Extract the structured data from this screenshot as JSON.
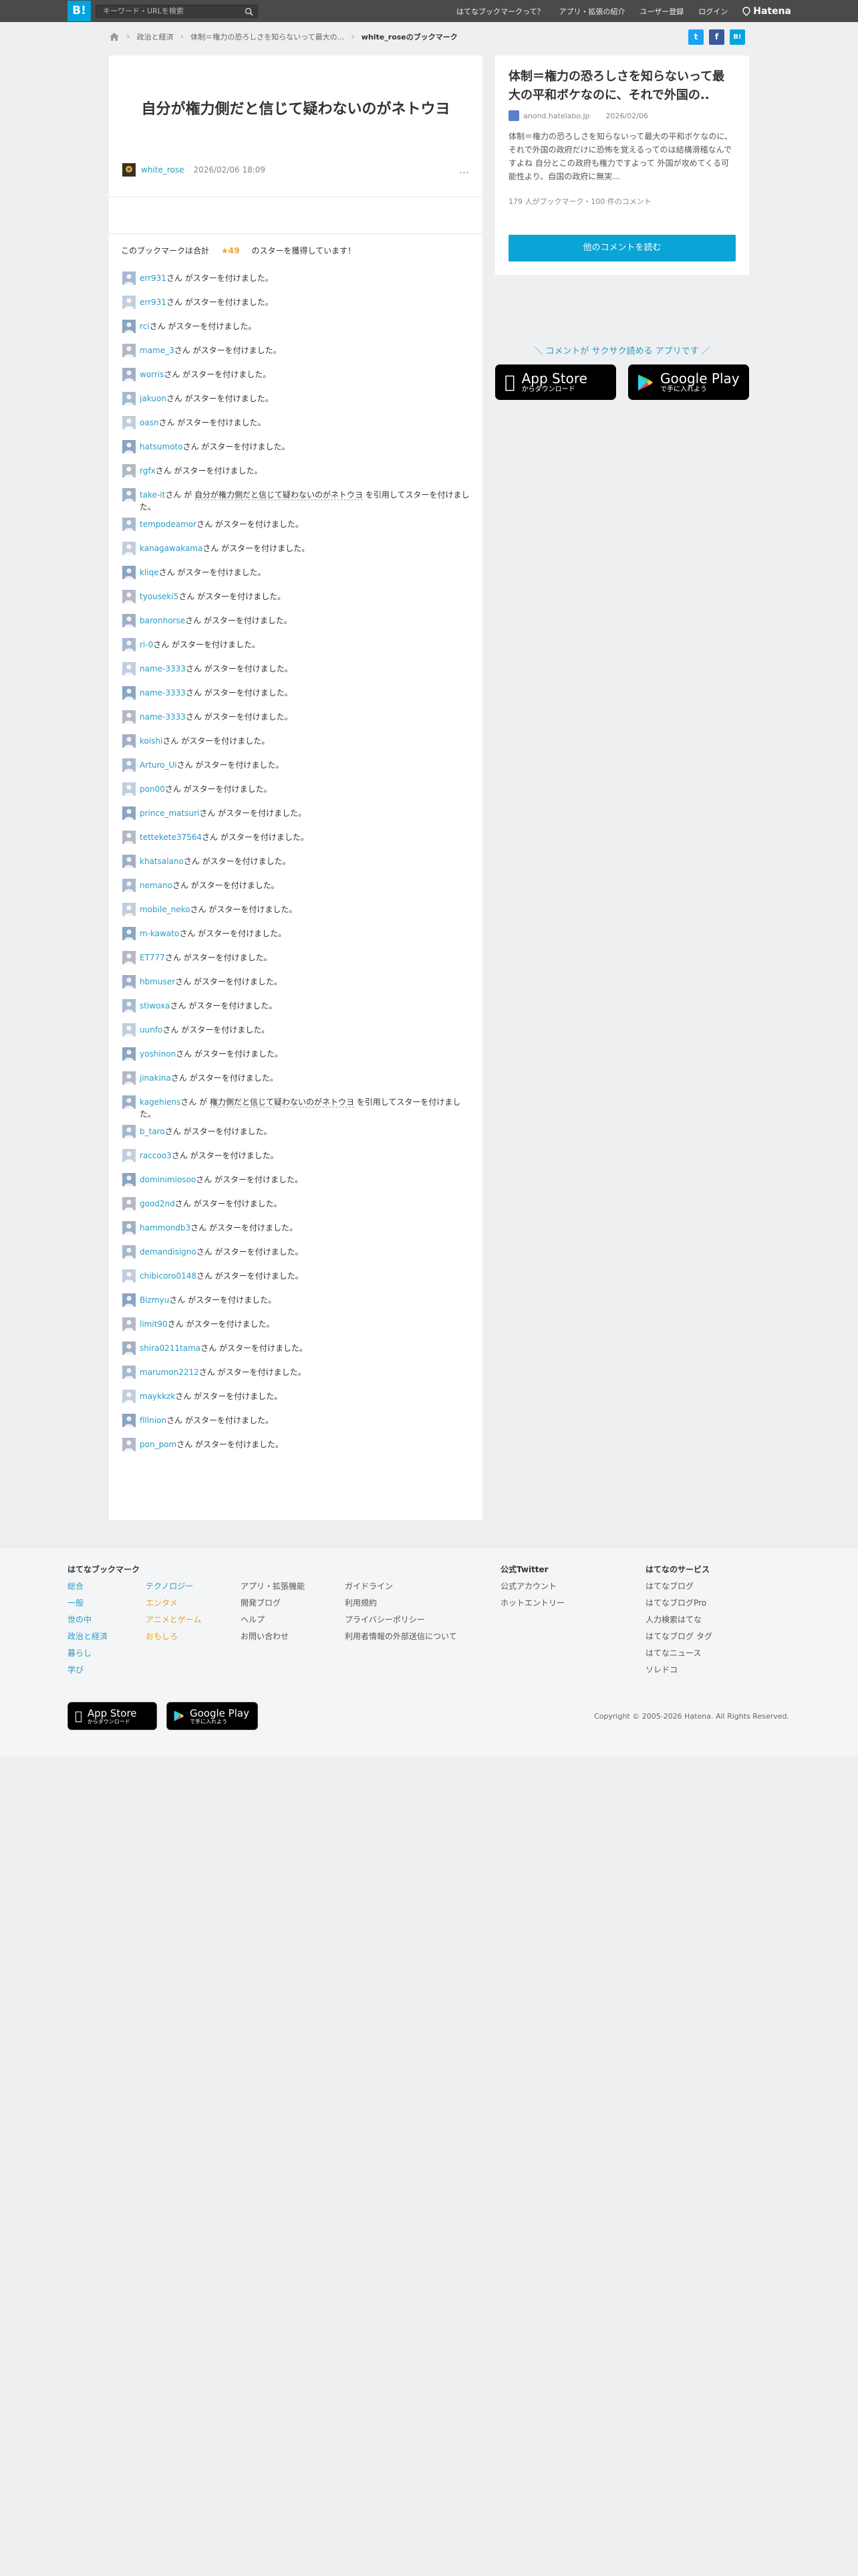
{
  "header": {
    "logo": "B!",
    "search_placeholder": "キーワード・URLを検索",
    "nav": [
      "はてなブックマークって？",
      "アプリ・拡張の紹介",
      "ユーザー登録",
      "ログイン"
    ],
    "brand": "Hatena"
  },
  "breadcrumb": {
    "items": [
      "政治と経済",
      "体制＝権力の恐ろしさを知らないって最大の..."
    ],
    "current": "white_roseのブックマーク"
  },
  "share": {
    "twitter": "t",
    "facebook": "f",
    "hatena": "B!"
  },
  "bookmark": {
    "title": "自分が権力側だと信じて疑わないのがネトウヨ",
    "user": "white_rose",
    "date": "2026/02/06 18:09",
    "more": "…",
    "summary_pre": "このブックマークは合計",
    "summary_star": "★49",
    "summary_post": "のスターを獲得しています！"
  },
  "stars": [
    {
      "user": "err931",
      "text": "さん がスターを付けました。"
    },
    {
      "user": "err931",
      "text": "さん がスターを付けました。"
    },
    {
      "user": "rci",
      "text": "さん がスターを付けました。"
    },
    {
      "user": "mame_3",
      "text": "さん がスターを付けました。"
    },
    {
      "user": "worris",
      "text": "さん がスターを付けました。"
    },
    {
      "user": "jakuon",
      "text": "さん がスターを付けました。"
    },
    {
      "user": "oasn",
      "text": "さん がスターを付けました。"
    },
    {
      "user": "hatsumoto",
      "text": "さん がスターを付けました。"
    },
    {
      "user": "rgfx",
      "text": "さん がスターを付けました。"
    },
    {
      "user": "take-it",
      "text": "さん が",
      "quote": "自分が権力側だと信じて疑わないのがネトウヨ",
      "text2": "を引用してスターを付けました。"
    },
    {
      "user": "tempodeamor",
      "text": "さん がスターを付けました。"
    },
    {
      "user": "kanagawakama",
      "text": "さん がスターを付けました。"
    },
    {
      "user": "kliqe",
      "text": "さん がスターを付けました。"
    },
    {
      "user": "tyouseki5",
      "text": "さん がスターを付けました。"
    },
    {
      "user": "baronhorse",
      "text": "さん がスターを付けました。"
    },
    {
      "user": "ri-0",
      "text": "さん がスターを付けました。"
    },
    {
      "user": "name-3333",
      "text": "さん がスターを付けました。"
    },
    {
      "user": "name-3333",
      "text": "さん がスターを付けました。"
    },
    {
      "user": "name-3333",
      "text": "さん がスターを付けました。"
    },
    {
      "user": "koishi",
      "text": "さん がスターを付けました。"
    },
    {
      "user": "Arturo_Ui",
      "text": "さん がスターを付けました。"
    },
    {
      "user": "pon00",
      "text": "さん がスターを付けました。"
    },
    {
      "user": "prince_matsuri",
      "text": "さん がスターを付けました。"
    },
    {
      "user": "tettekete37564",
      "text": "さん がスターを付けました。"
    },
    {
      "user": "khatsalano",
      "text": "さん がスターを付けました。"
    },
    {
      "user": "nemano",
      "text": "さん がスターを付けました。"
    },
    {
      "user": "mobile_neko",
      "text": "さん がスターを付けました。"
    },
    {
      "user": "m-kawato",
      "text": "さん がスターを付けました。"
    },
    {
      "user": "ET777",
      "text": "さん がスターを付けました。"
    },
    {
      "user": "hbmuser",
      "text": "さん がスターを付けました。"
    },
    {
      "user": "stiwoxa",
      "text": "さん がスターを付けました。"
    },
    {
      "user": "uunfo",
      "text": "さん がスターを付けました。"
    },
    {
      "user": "yoshinon",
      "text": "さん がスターを付けました。"
    },
    {
      "user": "jinakina",
      "text": "さん がスターを付けました。"
    },
    {
      "user": "kagehiens",
      "text": "さん が",
      "quote": "権力側だと信じて疑わないのがネトウヨ",
      "text2": "を引用してスターを付けました。"
    },
    {
      "user": "b_taro",
      "text": "さん がスターを付けました。"
    },
    {
      "user": "raccoo3",
      "text": "さん がスターを付けました。"
    },
    {
      "user": "dominimiosoo",
      "text": "さん がスターを付けました。"
    },
    {
      "user": "good2nd",
      "text": "さん がスターを付けました。"
    },
    {
      "user": "hammondb3",
      "text": "さん がスターを付けました。"
    },
    {
      "user": "demandisigno",
      "text": "さん がスターを付けました。"
    },
    {
      "user": "chibicoro0148",
      "text": "さん がスターを付けました。"
    },
    {
      "user": "Bizmyu",
      "text": "さん がスターを付けました。"
    },
    {
      "user": "limit90",
      "text": "さん がスターを付けました。"
    },
    {
      "user": "shira0211tama",
      "text": "さん がスターを付けました。"
    },
    {
      "user": "marumon2212",
      "text": "さん がスターを付けました。"
    },
    {
      "user": "maykkzk",
      "text": "さん がスターを付けました。"
    },
    {
      "user": "fillnion",
      "text": "さん がスターを付けました。"
    },
    {
      "user": "pon_pom",
      "text": "さん がスターを付けました。"
    }
  ],
  "entry": {
    "title": "体制＝権力の恐ろしさを知らないって最大の平和ボケなのに、それで外国の..",
    "source": "anond.hatelabo.jp",
    "date": "2026/02/06",
    "description": "体制＝権力の恐ろしさを知らないって最大の平和ボケなのに、それで外国の政府だけに恐怖を覚えるってのは結構滑稽なんですよね 自分とこの政府も権力ですよって 外国が攻めてくる可能性より、自国の政府に無実...",
    "stats": "179 人がブックマーク・100 件のコメント",
    "button": "他のコメントを読む"
  },
  "app_promo": {
    "tagline": "＼ コメントが サクサク読める アプリです ／",
    "appstore_l1": "App Store",
    "appstore_l2": "からダウンロード",
    "gplay_l1": "Google Play",
    "gplay_l2": "で手に入れよう"
  },
  "footer": {
    "col1_title": "はてなブックマーク",
    "cats_a": [
      "総合",
      "一般",
      "世の中",
      "政治と経済",
      "暮らし",
      "学び"
    ],
    "cats_b": [
      "テクノロジー",
      "エンタメ",
      "アニメとゲーム",
      "おもしろ"
    ],
    "links_c": [
      "アプリ・拡張機能",
      "開発ブログ",
      "ヘルプ",
      "お問い合わせ"
    ],
    "links_d": [
      "ガイドライン",
      "利用規約",
      "プライバシーポリシー",
      "利用者情報の外部送信について"
    ],
    "twitter_title": "公式Twitter",
    "twitter_links": [
      "公式アカウント",
      "ホットエントリー"
    ],
    "services_title": "はてなのサービス",
    "services": [
      "はてなブログ",
      "はてなブログPro",
      "人力検索はてな",
      "はてなブログ タグ",
      "はてなニュース",
      "ソレドコ"
    ],
    "copyright": "Copyright © 2005-2026 Hatena. All Rights Reserved."
  },
  "colors": {
    "accent": "#00a4de",
    "link": "#2a9bc4",
    "star": "#f2a12d"
  }
}
